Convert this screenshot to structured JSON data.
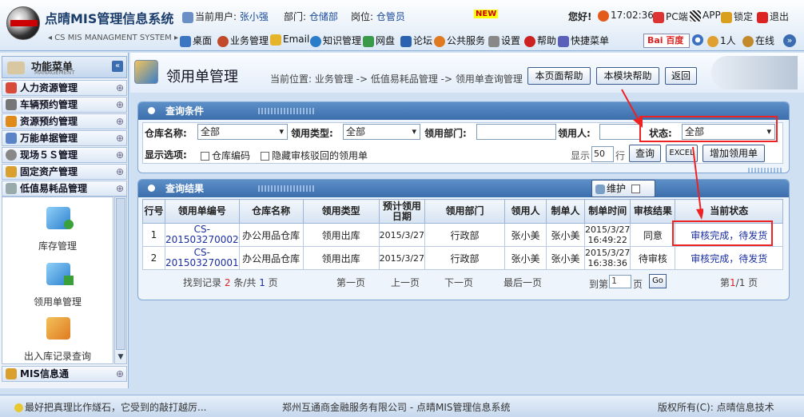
{
  "header": {
    "brand_name": "点晴MIS管理信息系统",
    "brand_sub": "CS MIS MANAGMENT SYSTEM",
    "user_label": "当前用户:",
    "user_value": "张小强",
    "dept_label": "部门:",
    "dept_value": "仓储部",
    "post_label": "岗位:",
    "post_value": "仓管员",
    "new_badge": "NEW",
    "greeting": "您好!",
    "clock": "17:02:36",
    "pc_label": "PC端",
    "app_label": "APP",
    "lock_label": "锁定",
    "exit_label": "退出",
    "nav": [
      "桌面",
      "业务管理",
      "Email",
      "知识管理",
      "网盘",
      "论坛",
      "公共服务",
      "设置",
      "帮助",
      "快捷菜单"
    ],
    "search_brand": "Bai 百度",
    "online_count": "1人",
    "online_label": "在线"
  },
  "sidebar": {
    "title": "功能菜单",
    "title_sub": "MANAGEMENT",
    "items": [
      "人力资源管理",
      "车辆预约管理",
      "资源预约管理",
      "万能单据管理",
      "现场５Ｓ管理",
      "固定资产管理",
      "低值易耗品管理"
    ],
    "sub_items": [
      "库存管理",
      "领用单管理",
      "出入库记录查询"
    ],
    "bottom_item": "MIS信息通"
  },
  "main": {
    "title": "领用单管理",
    "breadcrumb": "当前位置: 业务管理 -> 低值易耗品管理 -> 领用单查询管理",
    "help_page": "本页面帮助",
    "help_module": "本模块帮助",
    "back": "返回"
  },
  "query": {
    "title": "查询条件",
    "warehouse_label": "仓库名称:",
    "warehouse_value": "全部",
    "type_label": "领用类型:",
    "type_value": "全部",
    "dept_label": "领用部门:",
    "dept_value": "",
    "person_label": "领用人:",
    "person_value": "",
    "status_label": "状态:",
    "status_value": "全部",
    "options_label": "显示选项:",
    "opt_code": "仓库编码",
    "opt_hide": "隐藏审核驳回的领用单",
    "show_label": "显示",
    "show_count": "50",
    "rows_label": "行",
    "query_btn": "查询",
    "excel_btn": "EXCEL",
    "add_btn": "增加领用单"
  },
  "results": {
    "title": "查询结果",
    "maintain_label": "维护",
    "columns": [
      "行号",
      "领用单编号",
      "仓库名称",
      "领用类型",
      "预计领用日期",
      "领用部门",
      "领用人",
      "制单人",
      "制单时间",
      "审核结果",
      "当前状态"
    ],
    "rows": [
      {
        "no": "1",
        "code_a": "CS-",
        "code_b": "201503270002",
        "warehouse": "办公用品仓库",
        "type": "领用出库",
        "date": "2015/3/27",
        "dept": "行政部",
        "person": "张小美",
        "maker": "张小美",
        "time_a": "2015/3/27",
        "time_b": "16:49:22",
        "audit": "同意",
        "status": "审核完成，待发货"
      },
      {
        "no": "2",
        "code_a": "CS-",
        "code_b": "201503270001",
        "warehouse": "办公用品仓库",
        "type": "领用出库",
        "date": "2015/3/27",
        "dept": "行政部",
        "person": "张小美",
        "maker": "张小美",
        "time_a": "2015/3/27",
        "time_b": "16:38:36",
        "audit": "待审核",
        "status": "审核完成，待发货"
      }
    ],
    "pager": {
      "found_prefix": "找到记录",
      "found_count": "2",
      "found_mid": "条/共",
      "pages": "1",
      "found_suffix": "页",
      "first": "第一页",
      "prev": "上一页",
      "next": "下一页",
      "last": "最后一页",
      "goto_prefix": "到第",
      "goto_value": "1",
      "goto_suffix": "页",
      "go": "Go",
      "page_prefix": "第",
      "page_cur": "1",
      "page_total": "/1",
      "page_suffix": "页"
    }
  },
  "footer": {
    "tip": "最好把真理比作燧石，它受到的敲打越厉...",
    "company": "郑州互通商金融服务有限公司 - 点晴MIS管理信息系统",
    "copyright": "版权所有(C): 点晴信息技术"
  },
  "colors": {
    "accent": "#3b6eab",
    "annotation": "#ee2222"
  }
}
